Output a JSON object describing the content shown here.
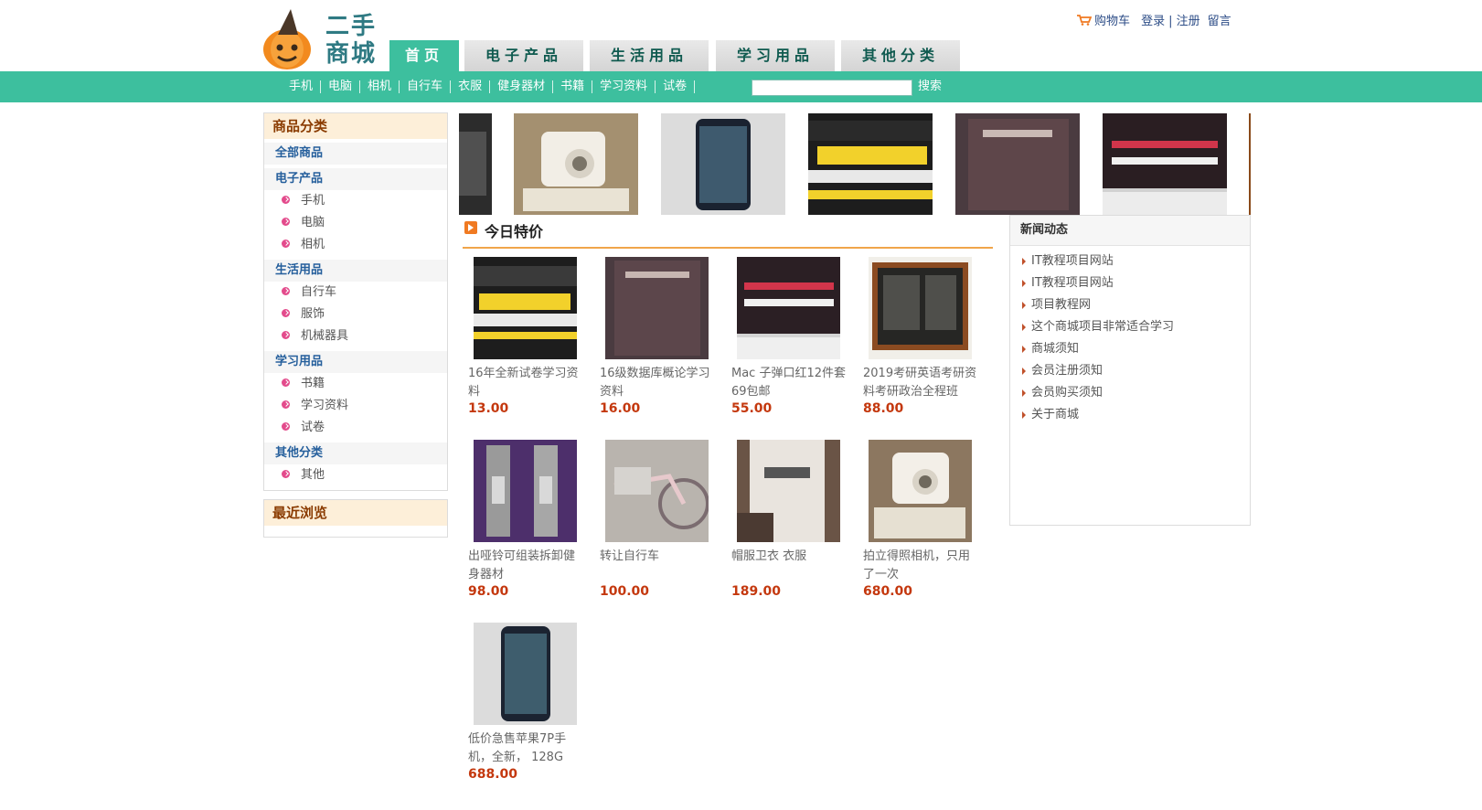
{
  "site": {
    "logo_text_line1": "二手",
    "logo_text_line2": "商城",
    "brand_color": "#3dbf9e",
    "accent_color": "#f0a54a",
    "price_color": "#c4380e"
  },
  "top_links": {
    "cart": "购物车",
    "login": "登录",
    "separator": "|",
    "register": "注册",
    "message": "留言"
  },
  "main_tabs": [
    {
      "label": "首页",
      "active": true
    },
    {
      "label": "电子产品",
      "active": false
    },
    {
      "label": "生活用品",
      "active": false
    },
    {
      "label": "学习用品",
      "active": false
    },
    {
      "label": "其他分类",
      "active": false
    }
  ],
  "subnav": {
    "items": [
      "手机",
      "电脑",
      "相机",
      "自行车",
      "衣服",
      "健身器材",
      "书籍",
      "学习资料",
      "试卷"
    ],
    "search_value": "",
    "search_button": "搜索"
  },
  "sidebar": {
    "title": "商品分类",
    "all": "全部商品",
    "groups": [
      {
        "label": "电子产品",
        "items": [
          "手机",
          "电脑",
          "相机"
        ]
      },
      {
        "label": "生活用品",
        "items": [
          "自行车",
          "服饰",
          "机械器具"
        ]
      },
      {
        "label": "学习用品",
        "items": [
          "书籍",
          "学习资料",
          "试卷"
        ]
      },
      {
        "label": "其他分类",
        "items": [
          "其他"
        ]
      }
    ],
    "recent_title": "最近浏览"
  },
  "special": {
    "title": "今日特价",
    "products": [
      {
        "name": "16年全新试卷学习资料",
        "price": "13.00",
        "image": "spark-exam-book"
      },
      {
        "name": "16级数据库概论学习资料",
        "price": "16.00",
        "image": "database-book"
      },
      {
        "name": "Mac 子弹口红12件套69包邮",
        "price": "55.00",
        "image": "lipstick-set"
      },
      {
        "name": "2019考研英语考研资料考研政治全程班",
        "price": "88.00",
        "image": "blackboard-course"
      },
      {
        "name": "出哑铃可组装拆卸健身器材",
        "price": "98.00",
        "image": "dumbbells"
      },
      {
        "name": "转让自行车",
        "price": "100.00",
        "image": "bicycle"
      },
      {
        "name": "帽服卫衣 衣服",
        "price": "189.00",
        "image": "hoodie"
      },
      {
        "name": "拍立得照相机，只用了一次",
        "price": "680.00",
        "image": "instant-camera"
      },
      {
        "name": "低价急售苹果7P手机，全新， 128G",
        "price": "688.00",
        "image": "iphone"
      }
    ]
  },
  "news": {
    "title": "新闻动态",
    "items": [
      "IT教程项目网站",
      "IT教程项目网站",
      "项目教程网",
      "这个商城项目非常适合学习",
      "商城须知",
      "会员注册须知",
      "会员购买须知",
      "关于商城"
    ]
  }
}
